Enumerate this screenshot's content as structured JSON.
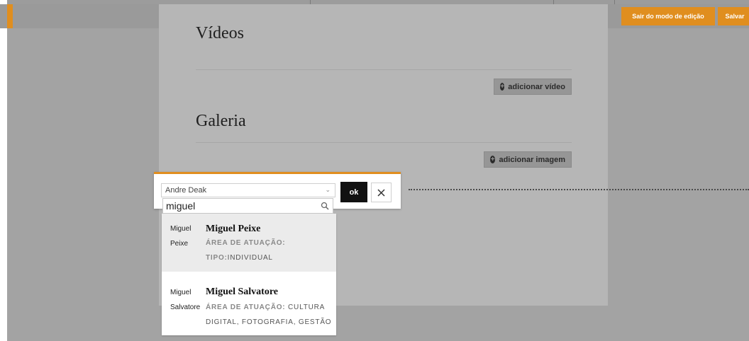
{
  "toolbar": {
    "exit_edit_label": "Sair do modo de edição",
    "save_label": "Salvar"
  },
  "sections": {
    "videos": {
      "title": "Vídeos",
      "add_label": "adicionar vídeo"
    },
    "gallery": {
      "title": "Galeria",
      "add_label": "adicionar imagem"
    }
  },
  "popup": {
    "select_value": "Andre Deak",
    "ok_label": "ok",
    "close_icon": "close-icon",
    "search_value": "miguel",
    "results": [
      {
        "thumb_label": "Miguel Peixe",
        "name": "Miguel Peixe",
        "area_label": "ÁREA DE ATUAÇÃO:",
        "area_value": "",
        "type_label": "TIPO:",
        "type_value": "INDIVIDUAL"
      },
      {
        "thumb_label": "Miguel Salvatore",
        "name": "Miguel Salvatore",
        "area_label": "ÁREA DE ATUAÇÃO:",
        "area_value": "CULTURA DIGITAL, FOTOGRAFIA, GESTÃO"
      }
    ]
  },
  "colors": {
    "accent": "#e08e1f",
    "overlay": "#a3a3a3",
    "ok_button": "#111111"
  }
}
